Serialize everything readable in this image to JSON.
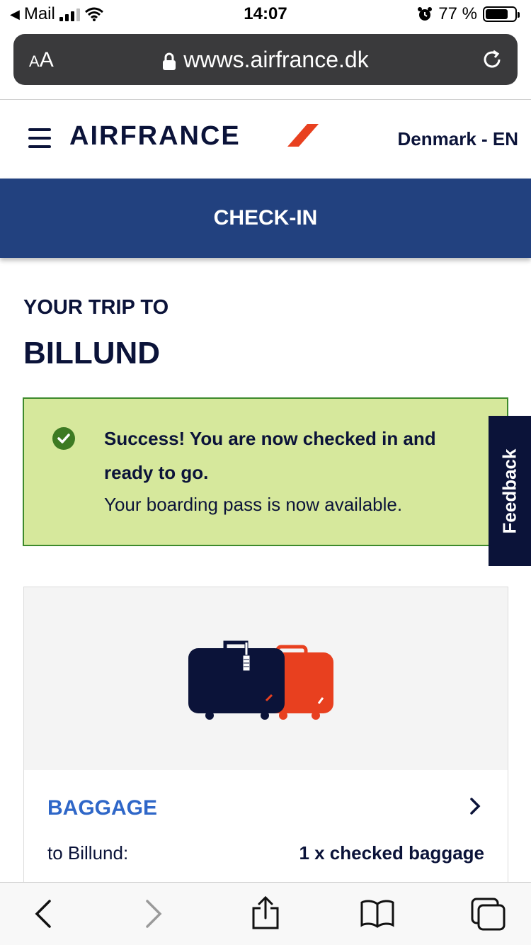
{
  "status_bar": {
    "back_app": "Mail",
    "time": "14:07",
    "battery_percent": "77 %",
    "battery_level": 0.77
  },
  "browser": {
    "text_size_label": "AA",
    "url": "wwws.airfrance.dk"
  },
  "header": {
    "logo_text": "AIRFRANCE",
    "locale": "Denmark - EN"
  },
  "band": {
    "title": "CHECK-IN"
  },
  "trip": {
    "heading": "YOUR TRIP TO",
    "destination": "BILLUND"
  },
  "success": {
    "title": "Success! You are now checked in and ready to go.",
    "subtitle": "Your boarding pass is now available."
  },
  "feedback": {
    "label": "Feedback"
  },
  "baggage": {
    "title": "BAGGAGE",
    "label": "to Billund:",
    "value": "1 x checked baggage"
  },
  "icons": {
    "check": "check-circle-icon",
    "chevron": "chevron-right-icon",
    "lock": "lock-icon",
    "reload": "reload-icon",
    "menu": "hamburger-menu-icon"
  },
  "colors": {
    "brand_navy": "#0b1339",
    "band_blue": "#22417f",
    "success_bg": "#d6e89c",
    "success_border": "#3d8a2c",
    "link_blue": "#2f67c8",
    "brand_red": "#e8401f"
  }
}
